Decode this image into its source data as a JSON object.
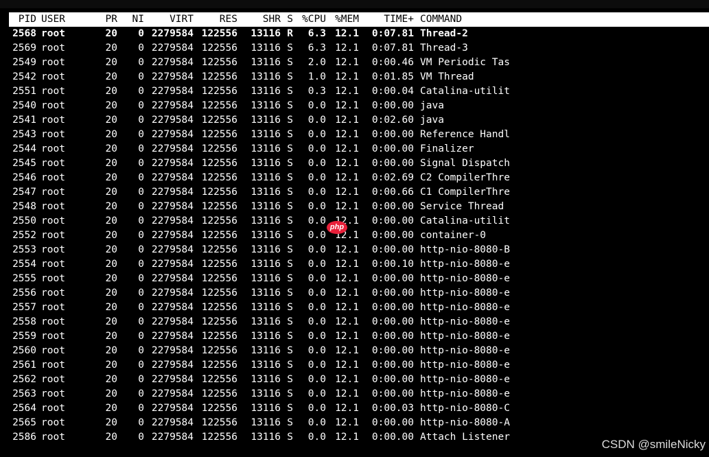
{
  "header": {
    "pid": "PID",
    "user": "USER",
    "pr": "PR",
    "ni": "NI",
    "virt": "VIRT",
    "res": "RES",
    "shr": "SHR",
    "s": "S",
    "cpu": "%CPU",
    "mem": "%MEM",
    "time": "TIME+",
    "command": "COMMAND"
  },
  "processes": [
    {
      "pid": "2568",
      "user": "root",
      "pr": "20",
      "ni": "0",
      "virt": "2279584",
      "res": "122556",
      "shr": "13116",
      "s": "R",
      "cpu": "6.3",
      "mem": "12.1",
      "time": "0:07.81",
      "command": "Thread-2"
    },
    {
      "pid": "2569",
      "user": "root",
      "pr": "20",
      "ni": "0",
      "virt": "2279584",
      "res": "122556",
      "shr": "13116",
      "s": "S",
      "cpu": "6.3",
      "mem": "12.1",
      "time": "0:07.81",
      "command": "Thread-3"
    },
    {
      "pid": "2549",
      "user": "root",
      "pr": "20",
      "ni": "0",
      "virt": "2279584",
      "res": "122556",
      "shr": "13116",
      "s": "S",
      "cpu": "2.0",
      "mem": "12.1",
      "time": "0:00.46",
      "command": "VM Periodic Tas"
    },
    {
      "pid": "2542",
      "user": "root",
      "pr": "20",
      "ni": "0",
      "virt": "2279584",
      "res": "122556",
      "shr": "13116",
      "s": "S",
      "cpu": "1.0",
      "mem": "12.1",
      "time": "0:01.85",
      "command": "VM Thread"
    },
    {
      "pid": "2551",
      "user": "root",
      "pr": "20",
      "ni": "0",
      "virt": "2279584",
      "res": "122556",
      "shr": "13116",
      "s": "S",
      "cpu": "0.3",
      "mem": "12.1",
      "time": "0:00.04",
      "command": "Catalina-utilit"
    },
    {
      "pid": "2540",
      "user": "root",
      "pr": "20",
      "ni": "0",
      "virt": "2279584",
      "res": "122556",
      "shr": "13116",
      "s": "S",
      "cpu": "0.0",
      "mem": "12.1",
      "time": "0:00.00",
      "command": "java"
    },
    {
      "pid": "2541",
      "user": "root",
      "pr": "20",
      "ni": "0",
      "virt": "2279584",
      "res": "122556",
      "shr": "13116",
      "s": "S",
      "cpu": "0.0",
      "mem": "12.1",
      "time": "0:02.60",
      "command": "java"
    },
    {
      "pid": "2543",
      "user": "root",
      "pr": "20",
      "ni": "0",
      "virt": "2279584",
      "res": "122556",
      "shr": "13116",
      "s": "S",
      "cpu": "0.0",
      "mem": "12.1",
      "time": "0:00.00",
      "command": "Reference Handl"
    },
    {
      "pid": "2544",
      "user": "root",
      "pr": "20",
      "ni": "0",
      "virt": "2279584",
      "res": "122556",
      "shr": "13116",
      "s": "S",
      "cpu": "0.0",
      "mem": "12.1",
      "time": "0:00.00",
      "command": "Finalizer"
    },
    {
      "pid": "2545",
      "user": "root",
      "pr": "20",
      "ni": "0",
      "virt": "2279584",
      "res": "122556",
      "shr": "13116",
      "s": "S",
      "cpu": "0.0",
      "mem": "12.1",
      "time": "0:00.00",
      "command": "Signal Dispatch"
    },
    {
      "pid": "2546",
      "user": "root",
      "pr": "20",
      "ni": "0",
      "virt": "2279584",
      "res": "122556",
      "shr": "13116",
      "s": "S",
      "cpu": "0.0",
      "mem": "12.1",
      "time": "0:02.69",
      "command": "C2 CompilerThre"
    },
    {
      "pid": "2547",
      "user": "root",
      "pr": "20",
      "ni": "0",
      "virt": "2279584",
      "res": "122556",
      "shr": "13116",
      "s": "S",
      "cpu": "0.0",
      "mem": "12.1",
      "time": "0:00.66",
      "command": "C1 CompilerThre"
    },
    {
      "pid": "2548",
      "user": "root",
      "pr": "20",
      "ni": "0",
      "virt": "2279584",
      "res": "122556",
      "shr": "13116",
      "s": "S",
      "cpu": "0.0",
      "mem": "12.1",
      "time": "0:00.00",
      "command": "Service Thread"
    },
    {
      "pid": "2550",
      "user": "root",
      "pr": "20",
      "ni": "0",
      "virt": "2279584",
      "res": "122556",
      "shr": "13116",
      "s": "S",
      "cpu": "0.0",
      "mem": "12.1",
      "time": "0:00.00",
      "command": "Catalina-utilit"
    },
    {
      "pid": "2552",
      "user": "root",
      "pr": "20",
      "ni": "0",
      "virt": "2279584",
      "res": "122556",
      "shr": "13116",
      "s": "S",
      "cpu": "0.0",
      "mem": "12.1",
      "time": "0:00.00",
      "command": "container-0"
    },
    {
      "pid": "2553",
      "user": "root",
      "pr": "20",
      "ni": "0",
      "virt": "2279584",
      "res": "122556",
      "shr": "13116",
      "s": "S",
      "cpu": "0.0",
      "mem": "12.1",
      "time": "0:00.00",
      "command": "http-nio-8080-B"
    },
    {
      "pid": "2554",
      "user": "root",
      "pr": "20",
      "ni": "0",
      "virt": "2279584",
      "res": "122556",
      "shr": "13116",
      "s": "S",
      "cpu": "0.0",
      "mem": "12.1",
      "time": "0:00.10",
      "command": "http-nio-8080-e"
    },
    {
      "pid": "2555",
      "user": "root",
      "pr": "20",
      "ni": "0",
      "virt": "2279584",
      "res": "122556",
      "shr": "13116",
      "s": "S",
      "cpu": "0.0",
      "mem": "12.1",
      "time": "0:00.00",
      "command": "http-nio-8080-e"
    },
    {
      "pid": "2556",
      "user": "root",
      "pr": "20",
      "ni": "0",
      "virt": "2279584",
      "res": "122556",
      "shr": "13116",
      "s": "S",
      "cpu": "0.0",
      "mem": "12.1",
      "time": "0:00.00",
      "command": "http-nio-8080-e"
    },
    {
      "pid": "2557",
      "user": "root",
      "pr": "20",
      "ni": "0",
      "virt": "2279584",
      "res": "122556",
      "shr": "13116",
      "s": "S",
      "cpu": "0.0",
      "mem": "12.1",
      "time": "0:00.00",
      "command": "http-nio-8080-e"
    },
    {
      "pid": "2558",
      "user": "root",
      "pr": "20",
      "ni": "0",
      "virt": "2279584",
      "res": "122556",
      "shr": "13116",
      "s": "S",
      "cpu": "0.0",
      "mem": "12.1",
      "time": "0:00.00",
      "command": "http-nio-8080-e"
    },
    {
      "pid": "2559",
      "user": "root",
      "pr": "20",
      "ni": "0",
      "virt": "2279584",
      "res": "122556",
      "shr": "13116",
      "s": "S",
      "cpu": "0.0",
      "mem": "12.1",
      "time": "0:00.00",
      "command": "http-nio-8080-e"
    },
    {
      "pid": "2560",
      "user": "root",
      "pr": "20",
      "ni": "0",
      "virt": "2279584",
      "res": "122556",
      "shr": "13116",
      "s": "S",
      "cpu": "0.0",
      "mem": "12.1",
      "time": "0:00.00",
      "command": "http-nio-8080-e"
    },
    {
      "pid": "2561",
      "user": "root",
      "pr": "20",
      "ni": "0",
      "virt": "2279584",
      "res": "122556",
      "shr": "13116",
      "s": "S",
      "cpu": "0.0",
      "mem": "12.1",
      "time": "0:00.00",
      "command": "http-nio-8080-e"
    },
    {
      "pid": "2562",
      "user": "root",
      "pr": "20",
      "ni": "0",
      "virt": "2279584",
      "res": "122556",
      "shr": "13116",
      "s": "S",
      "cpu": "0.0",
      "mem": "12.1",
      "time": "0:00.00",
      "command": "http-nio-8080-e"
    },
    {
      "pid": "2563",
      "user": "root",
      "pr": "20",
      "ni": "0",
      "virt": "2279584",
      "res": "122556",
      "shr": "13116",
      "s": "S",
      "cpu": "0.0",
      "mem": "12.1",
      "time": "0:00.00",
      "command": "http-nio-8080-e"
    },
    {
      "pid": "2564",
      "user": "root",
      "pr": "20",
      "ni": "0",
      "virt": "2279584",
      "res": "122556",
      "shr": "13116",
      "s": "S",
      "cpu": "0.0",
      "mem": "12.1",
      "time": "0:00.03",
      "command": "http-nio-8080-C"
    },
    {
      "pid": "2565",
      "user": "root",
      "pr": "20",
      "ni": "0",
      "virt": "2279584",
      "res": "122556",
      "shr": "13116",
      "s": "S",
      "cpu": "0.0",
      "mem": "12.1",
      "time": "0:00.00",
      "command": "http-nio-8080-A"
    },
    {
      "pid": "2586",
      "user": "root",
      "pr": "20",
      "ni": "0",
      "virt": "2279584",
      "res": "122556",
      "shr": "13116",
      "s": "S",
      "cpu": "0.0",
      "mem": "12.1",
      "time": "0:00.00",
      "command": "Attach Listener"
    }
  ],
  "watermark": "CSDN @smileNicky",
  "badge": "php",
  "colors": {
    "background": "#000000",
    "text": "#ffffff",
    "header_bg": "#ffffff",
    "header_text": "#000000",
    "badge": "#e8203a"
  }
}
